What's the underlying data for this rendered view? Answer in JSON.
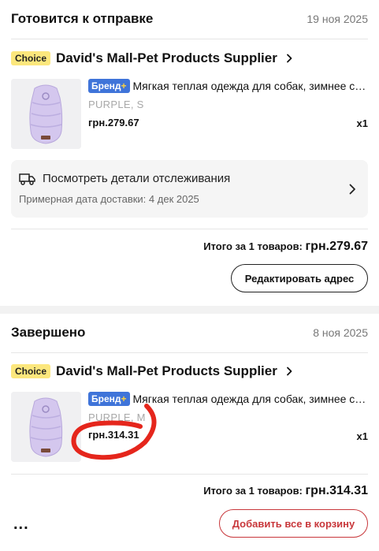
{
  "orders": [
    {
      "status": "Готовится к отправке",
      "date": "19 ноя 2025",
      "choice_label": "Choice",
      "store": "David's Mall-Pet Products Supplier",
      "brand_label": "Бренд",
      "brand_plus": "+",
      "product_title": "Мягкая теплая одежда для собак, зимнее стег...",
      "variant": "PURPLE, S",
      "price": "грн.279.67",
      "qty": "x1",
      "tracking_title": "Посмотреть детали отслеживания",
      "tracking_sub": "Примерная дата доставки: 4 дек 2025",
      "total_label": "Итого за 1 товаров:",
      "total_amount": "грн.279.67",
      "action_button": "Редактировать адрес"
    },
    {
      "status": "Завершено",
      "date": "8 ноя 2025",
      "choice_label": "Choice",
      "store": "David's Mall-Pet Products Supplier",
      "brand_label": "Бренд",
      "brand_plus": "+",
      "product_title": "Мягкая теплая одежда для собак, зимнее стег...",
      "variant": "PURPLE, M",
      "price": "грн.314.31",
      "qty": "x1",
      "total_label": "Итого за 1 товаров:",
      "total_amount": "грн.314.31",
      "more_label": "...",
      "action_button": "Добавить все в корзину"
    }
  ],
  "colors": {
    "choice_badge": "#fce77d",
    "brand_badge": "#3f74d9",
    "cart_button": "#c8373b",
    "annotation": "#e5261c"
  },
  "icons": [
    "truck-icon",
    "chevron-right-icon",
    "more-icon"
  ]
}
